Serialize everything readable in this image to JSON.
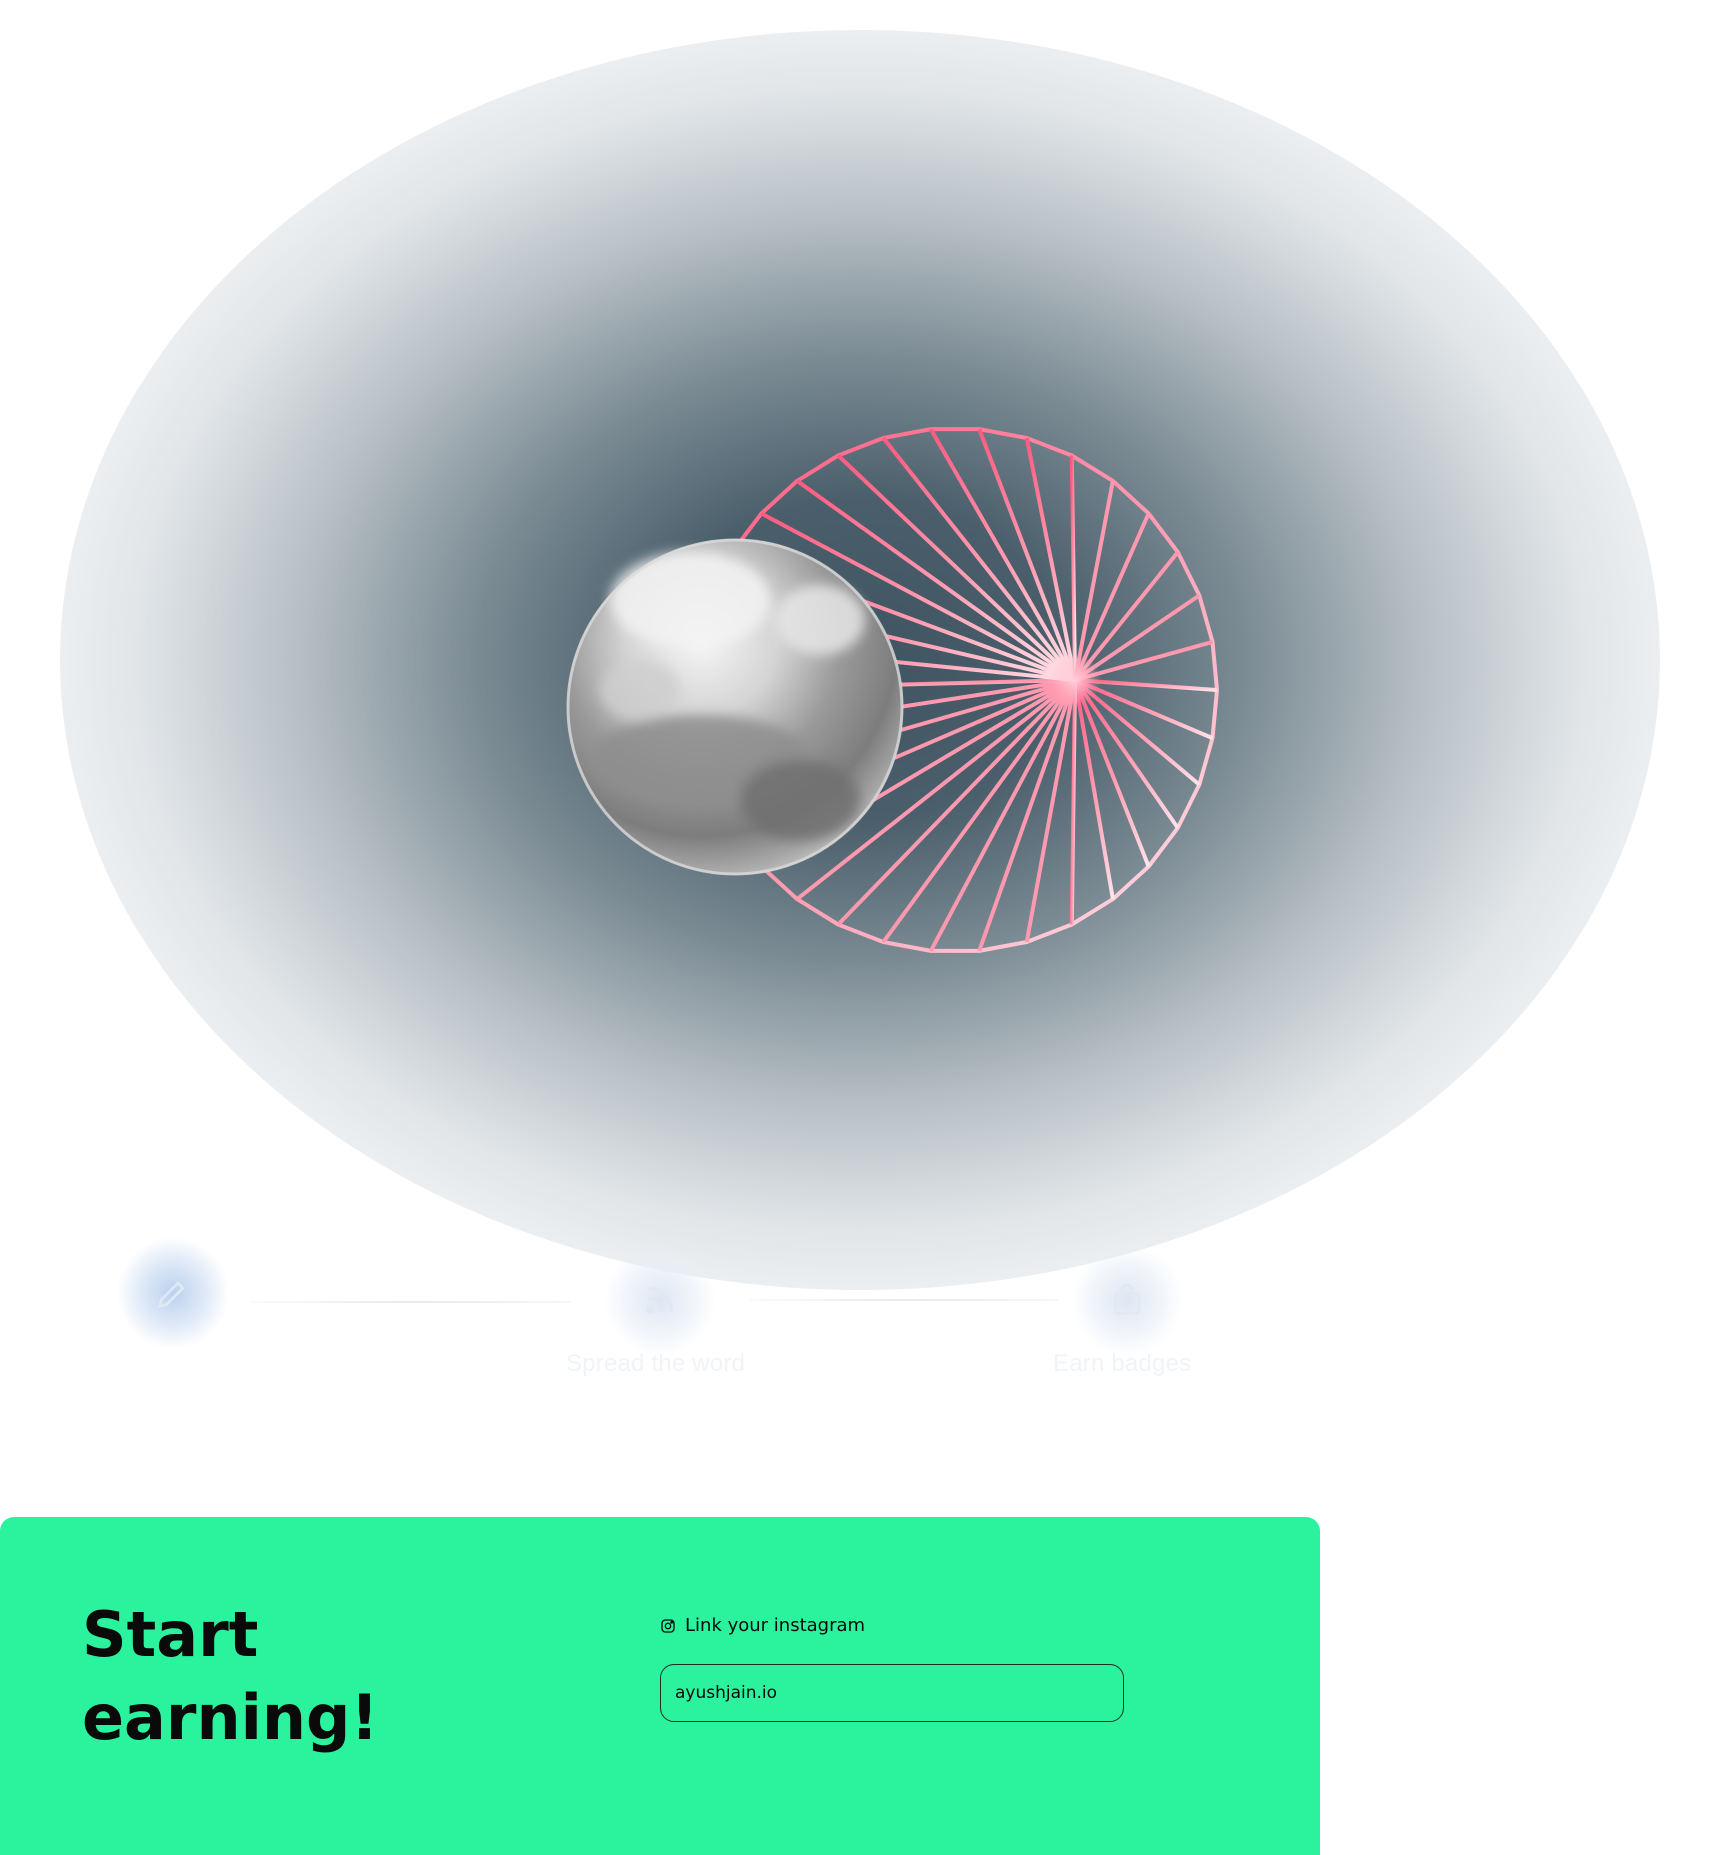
{
  "hero": {
    "sphere_color": "#b8b8b8",
    "wheel_color_start": "#ff6f8f",
    "wheel_color_end": "#ffd6de",
    "glow_color": "#3f5461"
  },
  "steps": [
    {
      "label": "",
      "icon": "pencil-icon",
      "active": true
    },
    {
      "label": "Spread the word",
      "icon": "rss-icon",
      "active": false
    },
    {
      "label": "Earn badges",
      "icon": "shopping-bag-icon",
      "active": false
    }
  ],
  "cta": {
    "title": "Start earning!",
    "instagram_label": "Link your instagram",
    "instagram_icon": "instagram-icon",
    "instagram_value": "ayushjain.io",
    "background": "#2bf39d"
  }
}
